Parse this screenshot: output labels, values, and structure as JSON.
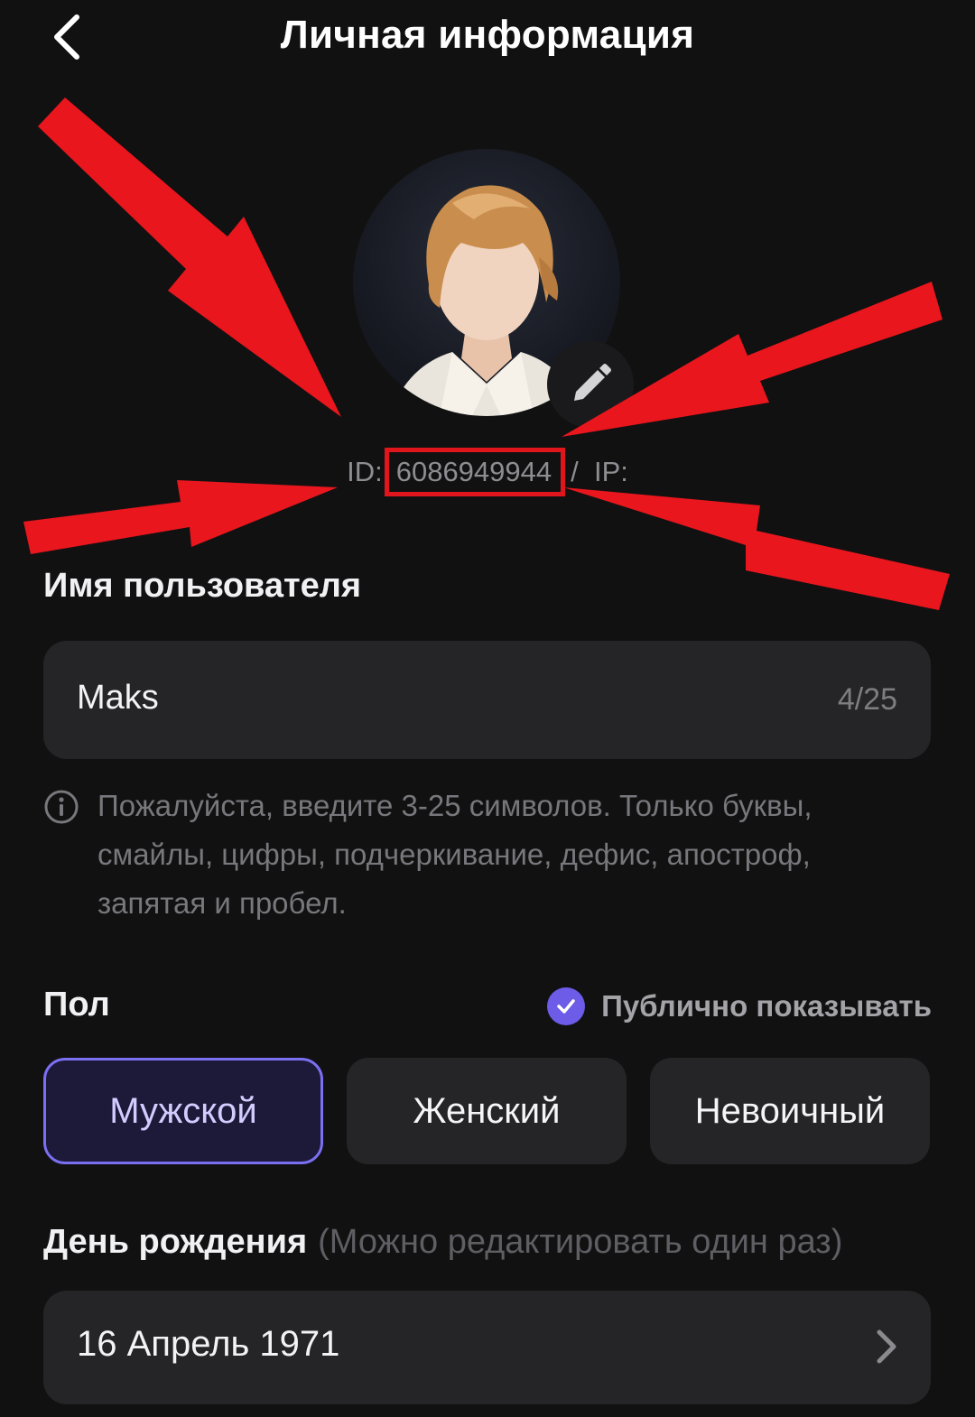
{
  "header": {
    "title": "Личная информация"
  },
  "profile": {
    "id_label": "ID:",
    "id_value": "6086949944",
    "separator": "/",
    "ip_label": "IP:"
  },
  "username": {
    "heading": "Имя пользователя",
    "value": "Maks",
    "counter": "4/25",
    "hint": "Пожалуйста, введите 3-25 символов. Только буквы, смайлы, цифры, подчеркивание, дефис, апостроф, запятая и пробел."
  },
  "gender": {
    "heading": "Пол",
    "public_label": "Публично показывать",
    "public_checked": true,
    "options": [
      {
        "label": "Мужской",
        "selected": true
      },
      {
        "label": "Женский",
        "selected": false
      },
      {
        "label": "Невоичный",
        "selected": false
      }
    ]
  },
  "birthday": {
    "heading": "День рождения",
    "note": "(Можно редактировать один раз)",
    "value": "16 Апрель 1971"
  },
  "colors": {
    "background": "#111112",
    "field": "#252527",
    "accent": "#7b6ff2",
    "annotation_red": "#e0161c"
  },
  "icons": {
    "back": "chevron-left-icon",
    "edit": "pencil-icon",
    "info": "info-icon",
    "check": "check-icon",
    "next": "chevron-right-icon"
  }
}
